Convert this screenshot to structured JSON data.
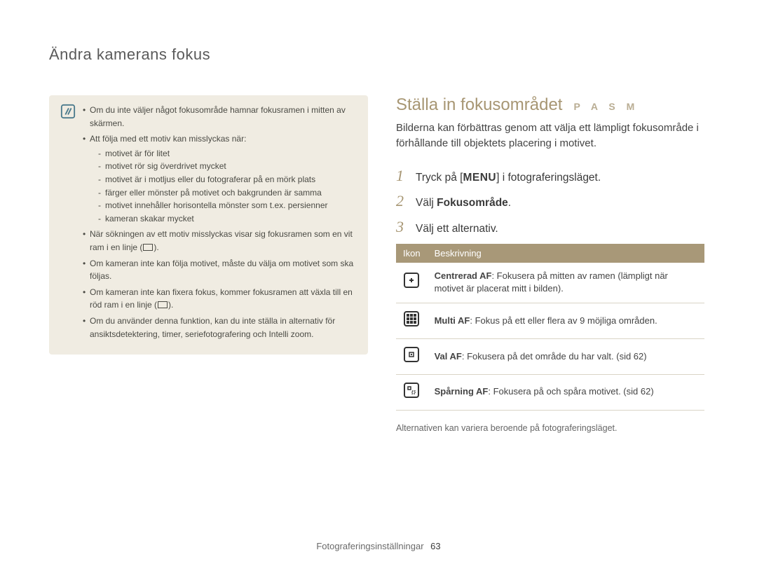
{
  "header": {
    "title": "Ändra kamerans fokus"
  },
  "note": {
    "items": [
      {
        "text": "Om du inte väljer något fokusområde hamnar fokusramen i mitten av skärmen."
      },
      {
        "text": "Att följa med ett motiv kan misslyckas när:",
        "sub": [
          "motivet är för litet",
          "motivet rör sig överdrivet mycket",
          "motivet är i motljus eller du fotograferar på en mörk plats",
          "färger eller mönster på motivet och bakgrunden är samma",
          "motivet innehåller horisontella mönster som t.ex. persienner",
          "kameran skakar mycket"
        ]
      },
      {
        "text_pre": "När sökningen av ett motiv misslyckas visar sig fokusramen som en vit ram i en linje (",
        "text_post": ")."
      },
      {
        "text": "Om kameran inte kan följa motivet, måste du välja om motivet som ska följas."
      },
      {
        "text_pre": "Om kameran inte kan fixera fokus, kommer fokusramen att växla till en röd ram i en linje (",
        "text_post": ")."
      },
      {
        "text": "Om du använder denna funktion, kan du inte ställa in alternativ för ansiktsdetektering, timer, seriefotografering och Intelli zoom."
      }
    ]
  },
  "section": {
    "title": "Ställa in fokusområdet",
    "modes": "P A S M",
    "intro": "Bilderna kan förbättras genom att välja ett lämpligt fokusområde i förhållande till objektets placering i motivet.",
    "steps": [
      {
        "num": "1",
        "pre": "Tryck på [",
        "menu": "MENU",
        "post": "] i fotograferingsläget."
      },
      {
        "num": "2",
        "pre": "Välj ",
        "bold": "Fokusområde",
        "post": "."
      },
      {
        "num": "3",
        "text": "Välj ett alternativ."
      }
    ],
    "table": {
      "head_icon": "Ikon",
      "head_desc": "Beskrivning",
      "rows": [
        {
          "bold": "Centrerad AF",
          "rest": ": Fokusera på mitten av ramen (lämpligt när motivet är placerat mitt i bilden)."
        },
        {
          "bold": "Multi AF",
          "rest": ": Fokus på ett eller flera av 9 möjliga områden."
        },
        {
          "bold": "Val AF",
          "rest": ": Fokusera på det område du har valt. (sid 62)"
        },
        {
          "bold": "Spårning AF",
          "rest": ": Fokusera på och spåra motivet. (sid 62)"
        }
      ]
    },
    "caption": "Alternativen kan variera beroende på fotograferingsläget."
  },
  "footer": {
    "label": "Fotograferingsinställningar",
    "page": "63"
  }
}
